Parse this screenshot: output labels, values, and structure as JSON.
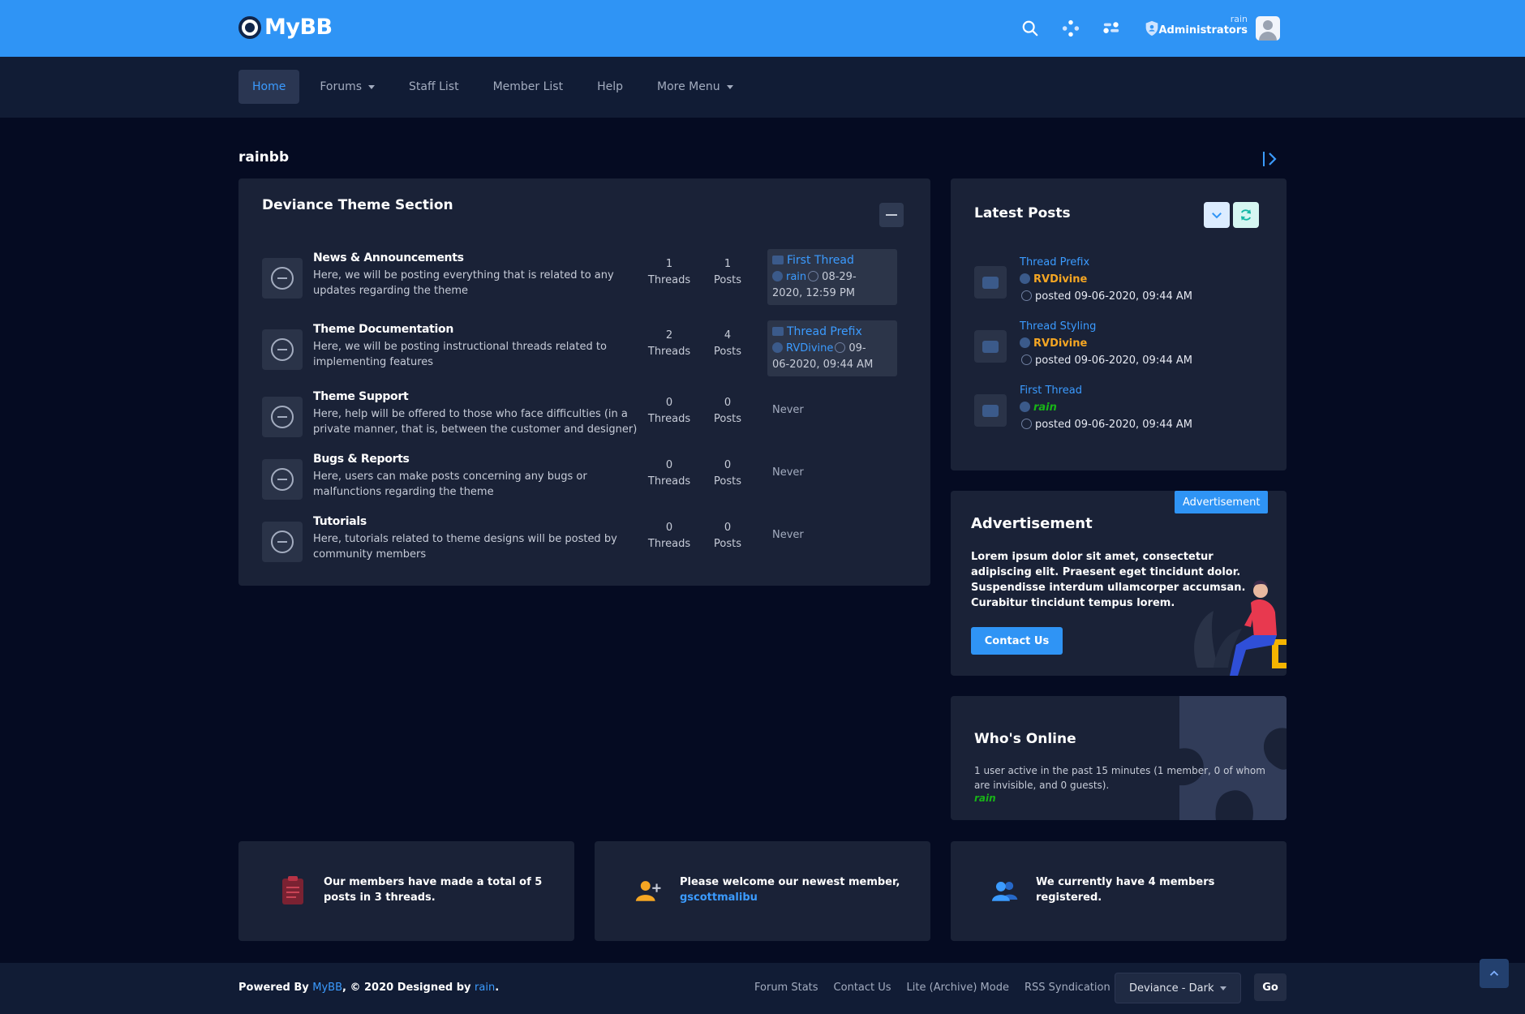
{
  "header": {
    "logo_text": "MyBB",
    "user_name": "rain",
    "user_group": "Administrators"
  },
  "nav": {
    "items": [
      {
        "label": "Home"
      },
      {
        "label": "Forums"
      },
      {
        "label": "Staff List"
      },
      {
        "label": "Member List"
      },
      {
        "label": "Help"
      },
      {
        "label": "More Menu"
      }
    ]
  },
  "board": {
    "title": "rainbb"
  },
  "section": {
    "title": "Deviance Theme Section",
    "forums": [
      {
        "name": "News & Announcements",
        "description": "Here, we will be posting everything that is related to any updates regarding the theme",
        "threads": "1",
        "threads_label": "Threads",
        "posts": "1",
        "posts_label": "Posts",
        "last_post": {
          "title": "First Thread",
          "user": "rain",
          "date_a": "08-29-",
          "date_b": "2020, 12:59 PM"
        }
      },
      {
        "name": "Theme Documentation",
        "description": "Here, we will be posting instructional threads related to implementing features",
        "threads": "2",
        "threads_label": "Threads",
        "posts": "4",
        "posts_label": "Posts",
        "last_post": {
          "title": "Thread Prefix",
          "user": "RVDivine",
          "date_a": "09-",
          "date_b": "06-2020, 09:44 AM"
        }
      },
      {
        "name": "Theme Support",
        "description": "Here, help will be offered to those who face difficulties (in a private manner, that is, between the customer and designer)",
        "threads": "0",
        "threads_label": "Threads",
        "posts": "0",
        "posts_label": "Posts",
        "last_post_text": "Never"
      },
      {
        "name": "Bugs & Reports",
        "description": "Here, users can make posts concerning any bugs or malfunctions regarding the theme",
        "threads": "0",
        "threads_label": "Threads",
        "posts": "0",
        "posts_label": "Posts",
        "last_post_text": "Never"
      },
      {
        "name": "Tutorials",
        "description": "Here, tutorials related to theme designs will be posted by community members",
        "threads": "0",
        "threads_label": "Threads",
        "posts": "0",
        "posts_label": "Posts",
        "last_post_text": "Never"
      }
    ]
  },
  "latest": {
    "title": "Latest Posts",
    "items": [
      {
        "title": "Thread Prefix",
        "author": "RVDivine",
        "author_color": "#f5a623",
        "date": "posted 09-06-2020, 09:44 AM"
      },
      {
        "title": "Thread Styling",
        "author": "RVDivine",
        "author_color": "#f5a623",
        "date": "posted 09-06-2020, 09:44 AM"
      },
      {
        "title": "First Thread",
        "author": "rain",
        "author_color": "#18b418",
        "date": "posted 09-06-2020, 09:44 AM"
      }
    ]
  },
  "ad": {
    "badge": "Advertisement",
    "title": "Advertisement",
    "text": "Lorem ipsum dolor sit amet, consectetur adipiscing elit. Praesent eget tincidunt dolor. Suspendisse interdum ullamcorper accumsan. Curabitur tincidunt tempus lorem.",
    "button": "Contact Us"
  },
  "online": {
    "title": "Who's Online",
    "text": "1 user active in the past 15 minutes (1 member, 0 of whom are invisible, and 0 guests).",
    "user": "rain"
  },
  "stats": {
    "posts_text": "Our members have made a total of 5 posts in 3 threads.",
    "newest_text": "Please welcome our newest member,",
    "newest_member": "gscottmalibu",
    "members_text": "We currently have 4 members registered."
  },
  "footer": {
    "powered_prefix": "Powered By",
    "powered_link": "MyBB",
    "powered_mid": ", © 2020 Designed by",
    "designer": "rain",
    "links": [
      "Forum Stats",
      "Contact Us",
      "Lite (Archive) Mode",
      "RSS Syndication"
    ],
    "theme": "Deviance - Dark",
    "go": "Go"
  },
  "colors": {
    "primary": "#2f94f5",
    "link": "#3b9bff",
    "background": "#050b22",
    "panel": "#1a2237",
    "nav": "#111c35",
    "admin_user": "#18b418",
    "author_orange": "#f5a623"
  }
}
